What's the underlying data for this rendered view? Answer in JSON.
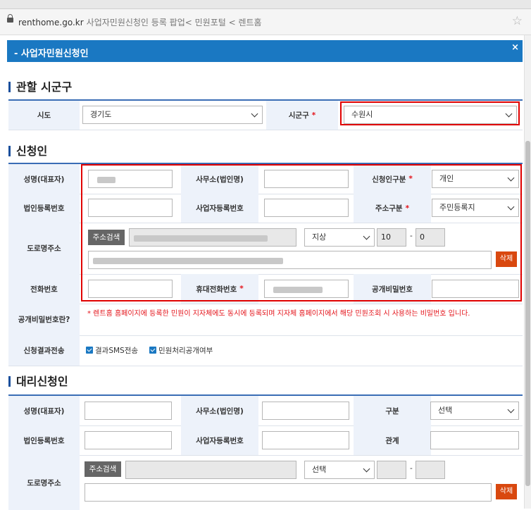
{
  "browser": {
    "domain": "renthome.go.kr",
    "page_title": "사업자민원신청인 등록 팝업< 민원포털 < 렌트홈"
  },
  "popup": {
    "title": "- 사업자민원신청인",
    "close": "×"
  },
  "jurisdiction": {
    "section_title": "관할 시군구",
    "sido_label": "시도",
    "sido_value": "경기도",
    "sigungu_label": "시군구",
    "sigungu_value": "수원시"
  },
  "applicant": {
    "section_title": "신청인",
    "name_label": "성명(대표자)",
    "office_label": "사무소(법인명)",
    "type_label": "신청인구분",
    "type_value": "개인",
    "corp_reg_label": "법인등록번호",
    "biz_reg_label": "사업자등록번호",
    "addr_type_label": "주소구분",
    "addr_type_value": "주민등록지",
    "road_addr_label": "도로명주소",
    "addr_search_btn": "주소검색",
    "land_type": "지상",
    "bldg_main": "10",
    "bldg_dash": "-",
    "bldg_sub": "0",
    "delete_btn": "삭제",
    "phone_label": "전화번호",
    "mobile_label": "휴대전화번호",
    "pw_label": "공개비밀번호",
    "pw_info_label": "공개비밀번호란?",
    "pw_info_text": "* 렌트홈 홈페이지에 등록한 민원이 지자체에도 동시에 등록되며 지자체 홈페이지에서 해당 민원조회 시 사용하는 비밀번호 입니다.",
    "result_label": "신청결과전송",
    "sms_check": "결과SMS전송",
    "public_check": "민원처리공개여부"
  },
  "agent": {
    "section_title": "대리신청인",
    "name_label": "성명(대표자)",
    "office_label": "사무소(법인명)",
    "type_label": "구분",
    "type_value": "선택",
    "corp_reg_label": "법인등록번호",
    "biz_reg_label": "사업자등록번호",
    "relation_label": "관계",
    "road_addr_label": "도로명주소",
    "addr_search_btn": "주소검색",
    "land_type": "선택",
    "bldg_dash": "-",
    "delete_btn": "삭제"
  },
  "colors": {
    "header_blue": "#1a78c2",
    "label_bg": "#edf2fa",
    "required_red": "#e4141b",
    "delete_orange": "#d9480f",
    "highlight_red": "#e00000"
  }
}
